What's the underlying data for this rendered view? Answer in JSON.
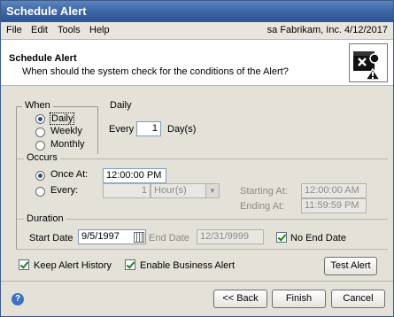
{
  "window": {
    "title": "Schedule Alert"
  },
  "menu": {
    "items": [
      {
        "label": "File"
      },
      {
        "label": "Edit"
      },
      {
        "label": "Tools"
      },
      {
        "label": "Help"
      }
    ],
    "info": "sa  Fabrikam, Inc.  4/12/2017"
  },
  "header": {
    "title": "Schedule Alert",
    "subtitle": "When should the system check for the conditions of the Alert?",
    "icon": "alert-calendar-icon"
  },
  "when": {
    "label": "When",
    "options": [
      {
        "label": "Daily",
        "selected": true
      },
      {
        "label": "Weekly",
        "selected": false
      },
      {
        "label": "Monthly",
        "selected": false
      }
    ]
  },
  "daily": {
    "label": "Daily",
    "every_label": "Every",
    "every_value": "1",
    "unit_label": "Day(s)"
  },
  "occurs": {
    "label": "Occurs",
    "once_label": "Once At:",
    "once_value": "12:00:00 PM",
    "every_label": "Every:",
    "every_value": "1",
    "every_unit": "Hour(s)",
    "starting_label": "Starting At:",
    "starting_value": "12:00:00 AM",
    "ending_label": "Ending At:",
    "ending_value": "11:59:59 PM"
  },
  "duration": {
    "label": "Duration",
    "start_label": "Start Date",
    "start_value": "9/5/1997",
    "end_label": "End Date",
    "end_value": "12/31/9999",
    "no_end_label": "No End Date",
    "no_end_checked": true
  },
  "options": {
    "keep_history_label": "Keep Alert History",
    "keep_history_checked": true,
    "enable_business_label": "Enable Business Alert",
    "enable_business_checked": true,
    "test_alert_label": "Test Alert"
  },
  "footer": {
    "back_label": "<< Back",
    "finish_label": "Finish",
    "cancel_label": "Cancel",
    "help_glyph": "?"
  }
}
